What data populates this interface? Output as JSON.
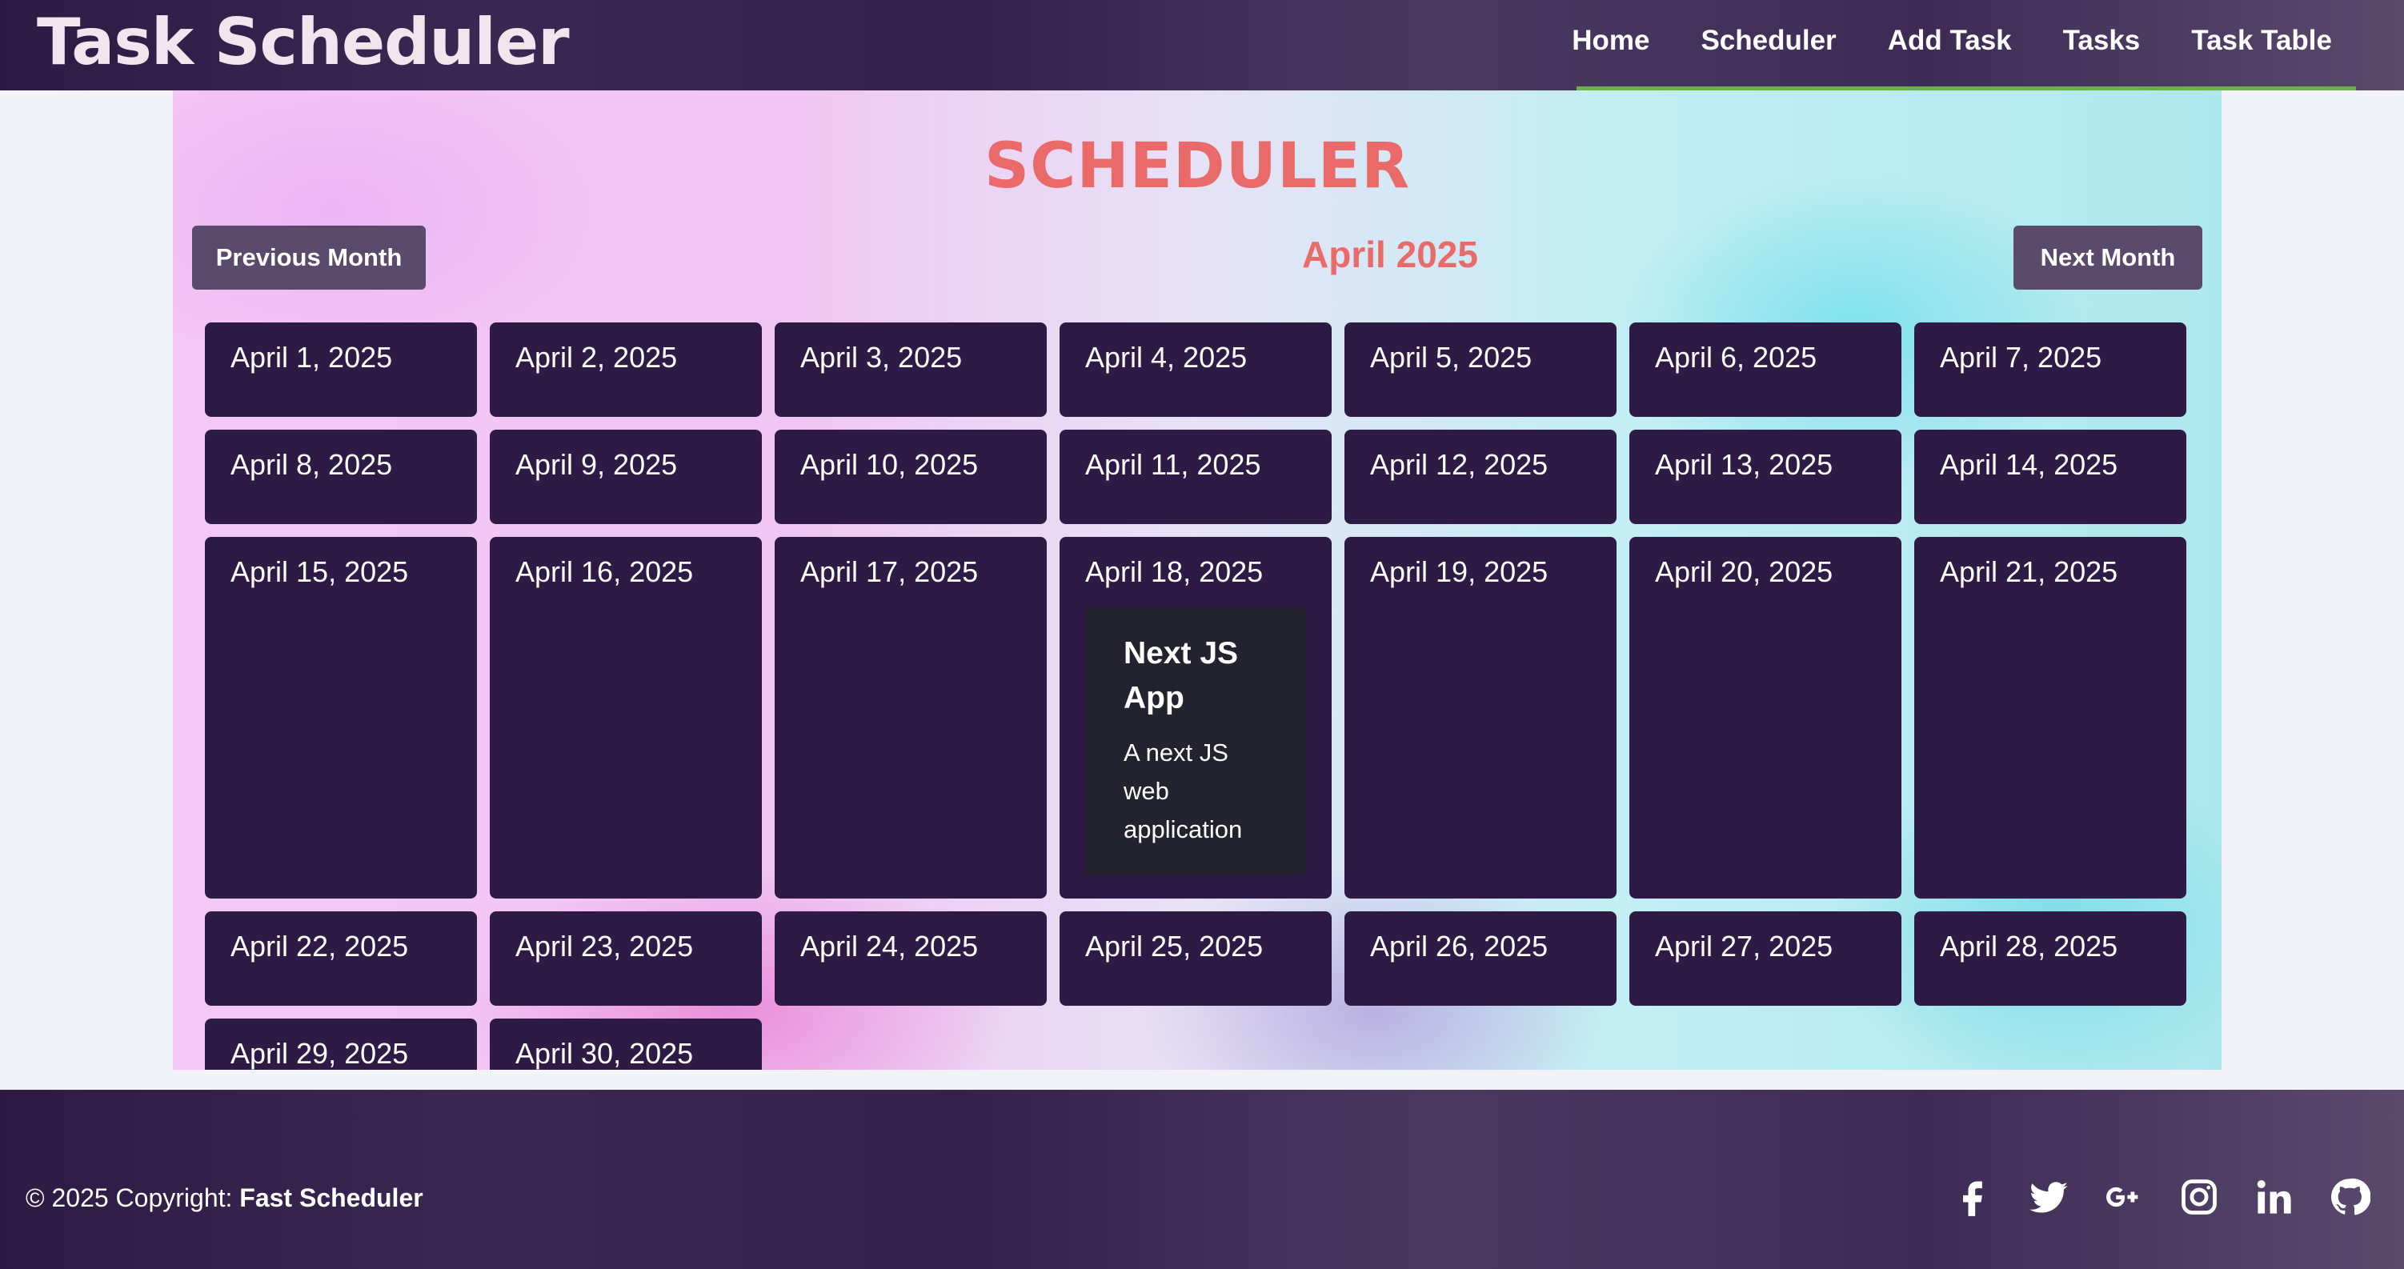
{
  "header": {
    "brand": "Task Scheduler",
    "nav": [
      "Home",
      "Scheduler",
      "Add Task",
      "Tasks",
      "Task Table"
    ]
  },
  "scheduler": {
    "title": "SCHEDULER",
    "prev_label": "Previous Month",
    "next_label": "Next Month",
    "month": "April 2025",
    "days": [
      "April 1, 2025",
      "April 2, 2025",
      "April 3, 2025",
      "April 4, 2025",
      "April 5, 2025",
      "April 6, 2025",
      "April 7, 2025",
      "April 8, 2025",
      "April 9, 2025",
      "April 10, 2025",
      "April 11, 2025",
      "April 12, 2025",
      "April 13, 2025",
      "April 14, 2025",
      "April 15, 2025",
      "April 16, 2025",
      "April 17, 2025",
      "April 18, 2025",
      "April 19, 2025",
      "April 20, 2025",
      "April 21, 2025",
      "April 22, 2025",
      "April 23, 2025",
      "April 24, 2025",
      "April 25, 2025",
      "April 26, 2025",
      "April 27, 2025",
      "April 28, 2025",
      "April 29, 2025",
      "April 30, 2025"
    ],
    "task": {
      "date": "April 18, 2025",
      "title": "Next JS App",
      "description": "A next JS web application"
    }
  },
  "footer": {
    "copyright_prefix": "© 2025 Copyright: ",
    "copyright_brand": "Fast Scheduler",
    "social": [
      "facebook-icon",
      "twitter-icon",
      "google-plus-icon",
      "instagram-icon",
      "linkedin-icon",
      "github-icon"
    ]
  }
}
